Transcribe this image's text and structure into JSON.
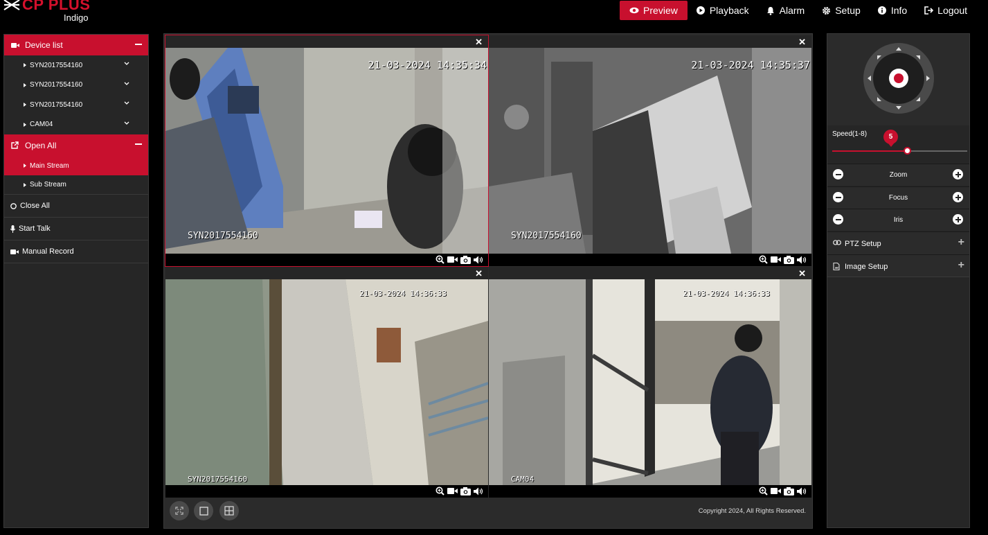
{
  "app": {
    "brand": "CP PLUS",
    "brand_sub": "Indigo",
    "colors": {
      "accent": "#c8102e",
      "background": "#000000",
      "panel": "#262626"
    }
  },
  "nav": {
    "preview": "Preview",
    "playback": "Playback",
    "alarm": "Alarm",
    "setup": "Setup",
    "info": "Info",
    "logout": "Logout"
  },
  "sidebar": {
    "device_list_title": "Device list",
    "devices": [
      {
        "label": "SYN2017554160"
      },
      {
        "label": "SYN2017554160"
      },
      {
        "label": "SYN2017554160"
      },
      {
        "label": "CAM04"
      }
    ],
    "open_all_title": "Open All",
    "streams": [
      {
        "label": "Main Stream",
        "active": true
      },
      {
        "label": "Sub Stream",
        "active": false
      }
    ],
    "close_all": "Close All",
    "start_talk": "Start Talk",
    "manual_record": "Manual Record"
  },
  "cameras": [
    {
      "timestamp": "21-03-2024 14:35:34",
      "label": "SYN2017554160",
      "selected": true
    },
    {
      "timestamp": "21-03-2024 14:35:37",
      "label": "SYN2017554160",
      "selected": false
    },
    {
      "timestamp": "21-03-2024 14:36:33",
      "label": "SYN2017554160",
      "selected": false
    },
    {
      "timestamp": "21-03-2024 14:36:33",
      "label": "CAM04",
      "selected": false
    }
  ],
  "footer": {
    "copyright": "Copyright 2024, All Rights Reserved."
  },
  "ptz": {
    "speed_label": "Speed(1-8)",
    "speed_value": "5",
    "speed_min": 1,
    "speed_max": 8,
    "zoom": "Zoom",
    "focus": "Focus",
    "iris": "Iris",
    "ptz_setup": "PTZ Setup",
    "image_setup": "Image Setup"
  }
}
